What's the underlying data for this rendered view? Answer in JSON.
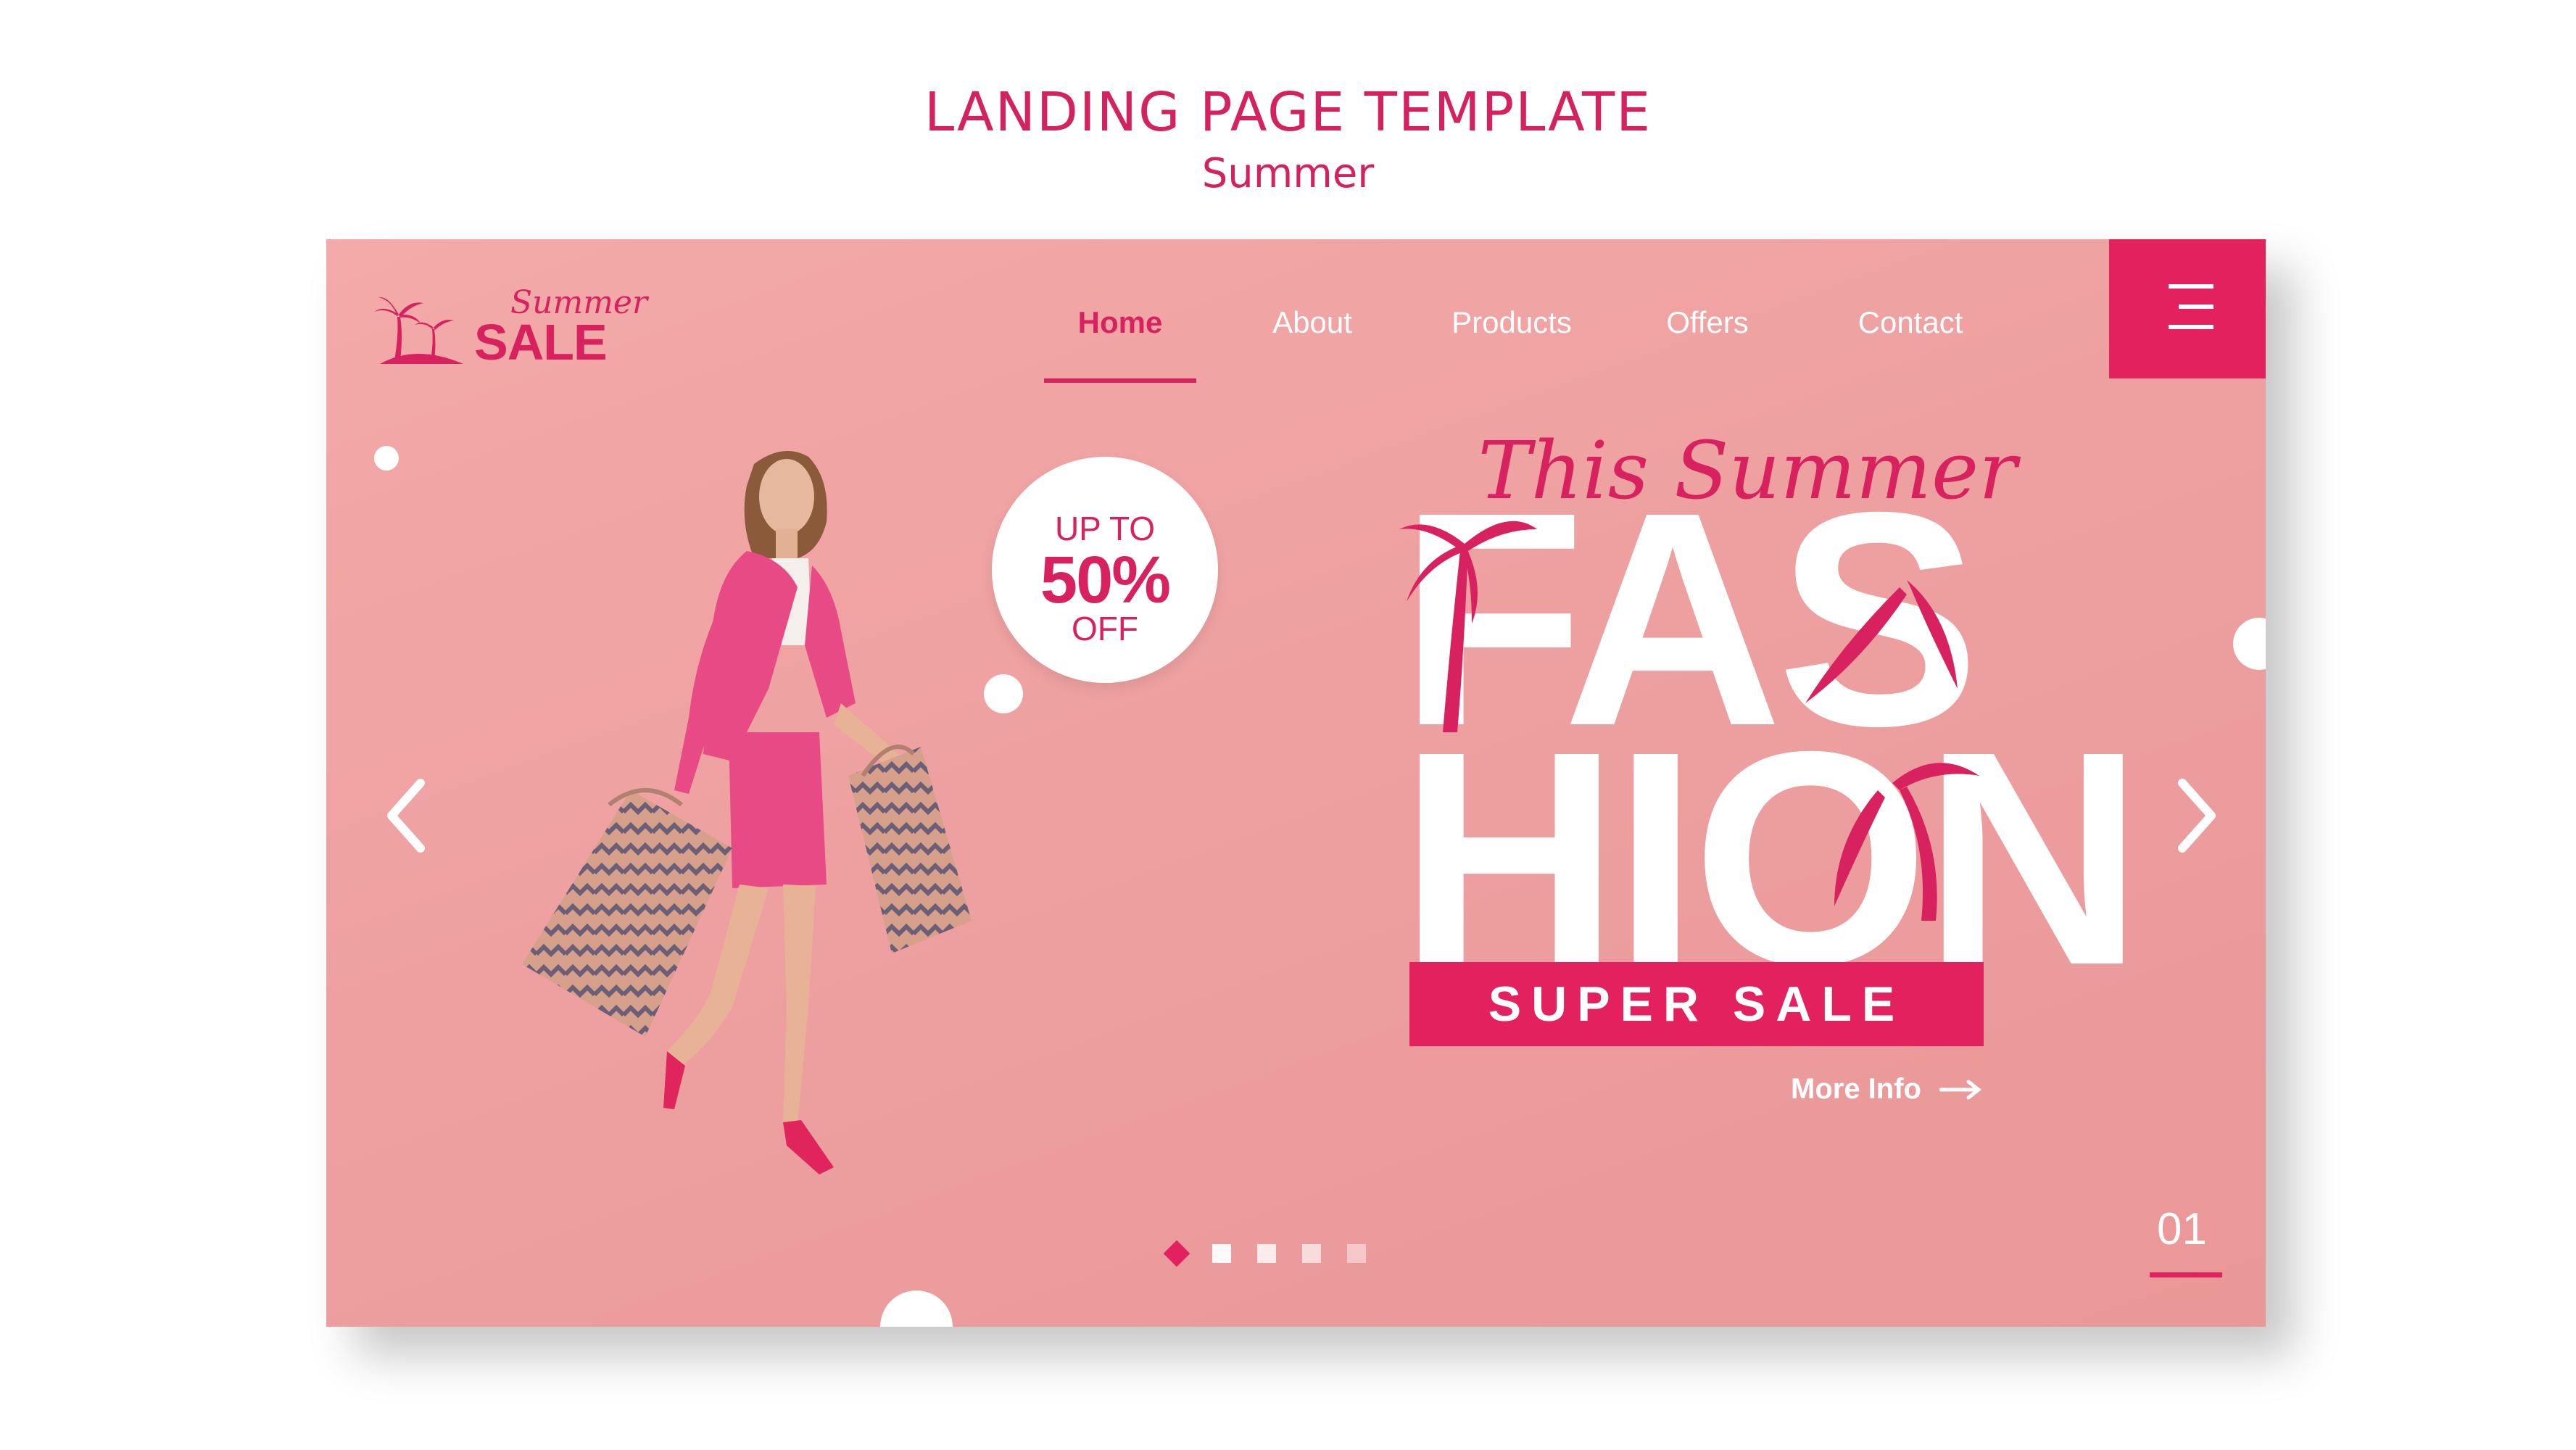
{
  "header": {
    "title": "LANDING PAGE TEMPLATE",
    "subtitle": "Summer"
  },
  "logo": {
    "script": "Summer",
    "text": "SALE"
  },
  "nav": {
    "items": [
      {
        "label": "Home",
        "active": true
      },
      {
        "label": "About",
        "active": false
      },
      {
        "label": "Products",
        "active": false
      },
      {
        "label": "Offers",
        "active": false
      },
      {
        "label": "Contact",
        "active": false
      }
    ]
  },
  "badge": {
    "top": "UP TO",
    "value": "50%",
    "bottom": "OFF"
  },
  "hero": {
    "script": "This Summer",
    "line1": "FAS",
    "line2": "HION",
    "banner": "SUPER SALE",
    "link": "More Info"
  },
  "pager": {
    "total": 5,
    "active": 0,
    "slide_number": "01"
  },
  "icons": {
    "menu": "hamburger-icon",
    "prev": "chevron-left-icon",
    "next": "chevron-right-icon",
    "more": "arrow-right-icon",
    "logo": "palm-tree-icon"
  },
  "colors": {
    "accent": "#e3215f",
    "background": "#f0a3a3",
    "text_light": "#ffffff"
  }
}
